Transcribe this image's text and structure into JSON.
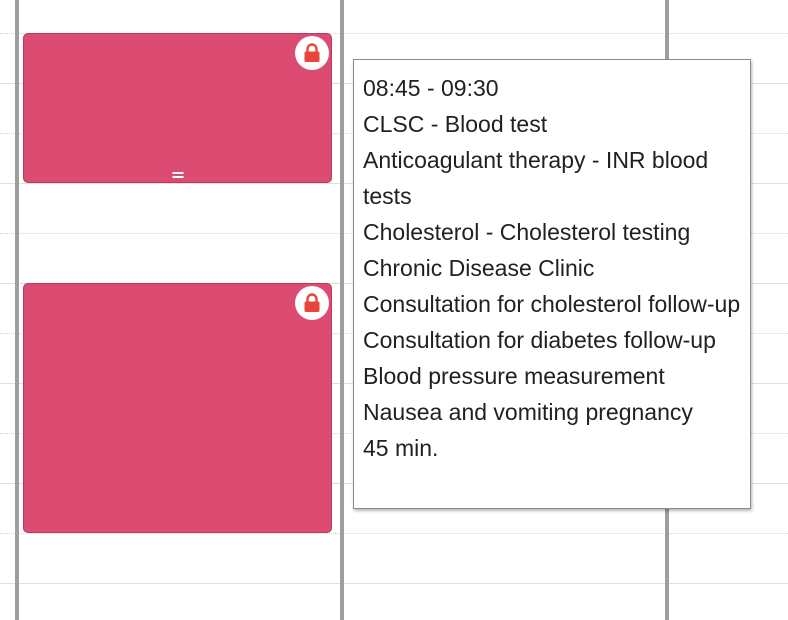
{
  "calendar": {
    "events": [
      {
        "locked": true,
        "icon": "lock-icon",
        "color": "#db4b72"
      },
      {
        "locked": true,
        "icon": "lock-icon",
        "color": "#db4b72"
      }
    ]
  },
  "tooltip": {
    "time_range": "08:45 - 09:30",
    "lines": [
      "CLSC - Blood test",
      "Anticoagulant therapy - INR blood tests",
      "Cholesterol - Cholesterol testing",
      "Chronic Disease Clinic",
      "Consultation for cholesterol follow-up",
      "Consultation for diabetes follow-up",
      "Blood pressure measurement",
      "Nausea and vomiting pregnancy"
    ],
    "duration": "45 min."
  },
  "colors": {
    "event_fill": "#db4b72",
    "lock_icon": "#e8453c",
    "column_divider": "#9e9e9e"
  }
}
